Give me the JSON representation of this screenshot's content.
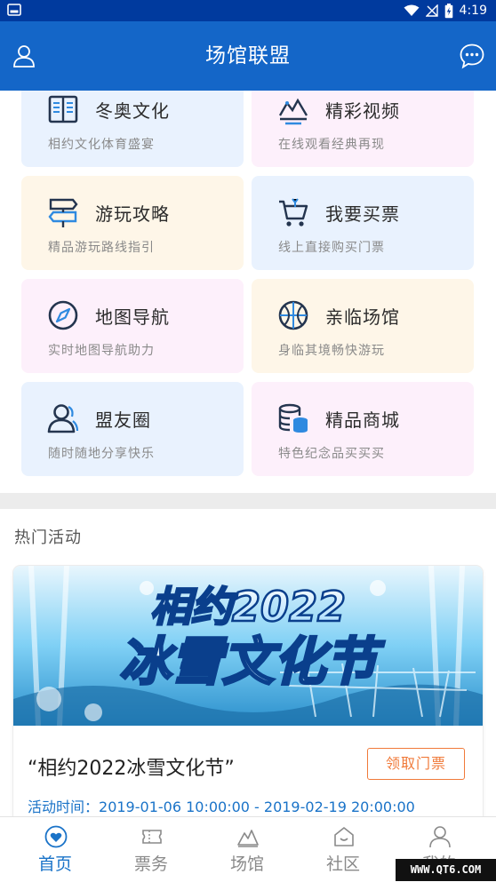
{
  "status_bar": {
    "time": "4:19"
  },
  "app_bar": {
    "title": "场馆联盟"
  },
  "features": [
    {
      "title": "冬奥文化",
      "subtitle": "相约文化体育盛宴",
      "icon": "book-icon",
      "bg": "#e9f2fe"
    },
    {
      "title": "精彩视频",
      "subtitle": "在线观看经典再现",
      "icon": "video-icon",
      "bg": "#fdf0fb"
    },
    {
      "title": "游玩攻略",
      "subtitle": "精品游玩路线指引",
      "icon": "signpost-icon",
      "bg": "#fef6e8"
    },
    {
      "title": "我要买票",
      "subtitle": "线上直接购买门票",
      "icon": "cart-icon",
      "bg": "#e9f2fe"
    },
    {
      "title": "地图导航",
      "subtitle": "实时地图导航助力",
      "icon": "compass-icon",
      "bg": "#fdf0fb"
    },
    {
      "title": "亲临场馆",
      "subtitle": "身临其境畅快游玩",
      "icon": "stadium-icon",
      "bg": "#fef6e8"
    },
    {
      "title": "盟友圈",
      "subtitle": "随时随地分享快乐",
      "icon": "friends-icon",
      "bg": "#e9f2fe"
    },
    {
      "title": "精品商城",
      "subtitle": "特色纪念品买买买",
      "icon": "coins-icon",
      "bg": "#fdf0fb"
    }
  ],
  "section": {
    "title": "热门活动"
  },
  "event": {
    "banner_text_top": "相约2022",
    "banner_text_bottom": "冰雪文化节",
    "name": "“相约2022冰雪文化节”",
    "ticket_button": "领取门票",
    "time_label": "活动时间：",
    "time_value": "2019-01-06 10:00:00 - 2019-02-19 20:00:00"
  },
  "bottom_nav": [
    {
      "label": "首页",
      "icon": "home-heart-icon",
      "active": true
    },
    {
      "label": "票务",
      "icon": "ticket-icon",
      "active": false
    },
    {
      "label": "场馆",
      "icon": "venue-icon",
      "active": false
    },
    {
      "label": "社区",
      "icon": "community-icon",
      "active": false
    },
    {
      "label": "我的",
      "icon": "profile-icon",
      "active": false
    }
  ],
  "watermark": "WWW.QT6.COM",
  "colors": {
    "primary": "#1466c8",
    "status_bar": "#003a9e",
    "accent_orange": "#f07a3a",
    "link_blue": "#1a73c8",
    "icon_dark": "#24354f"
  }
}
